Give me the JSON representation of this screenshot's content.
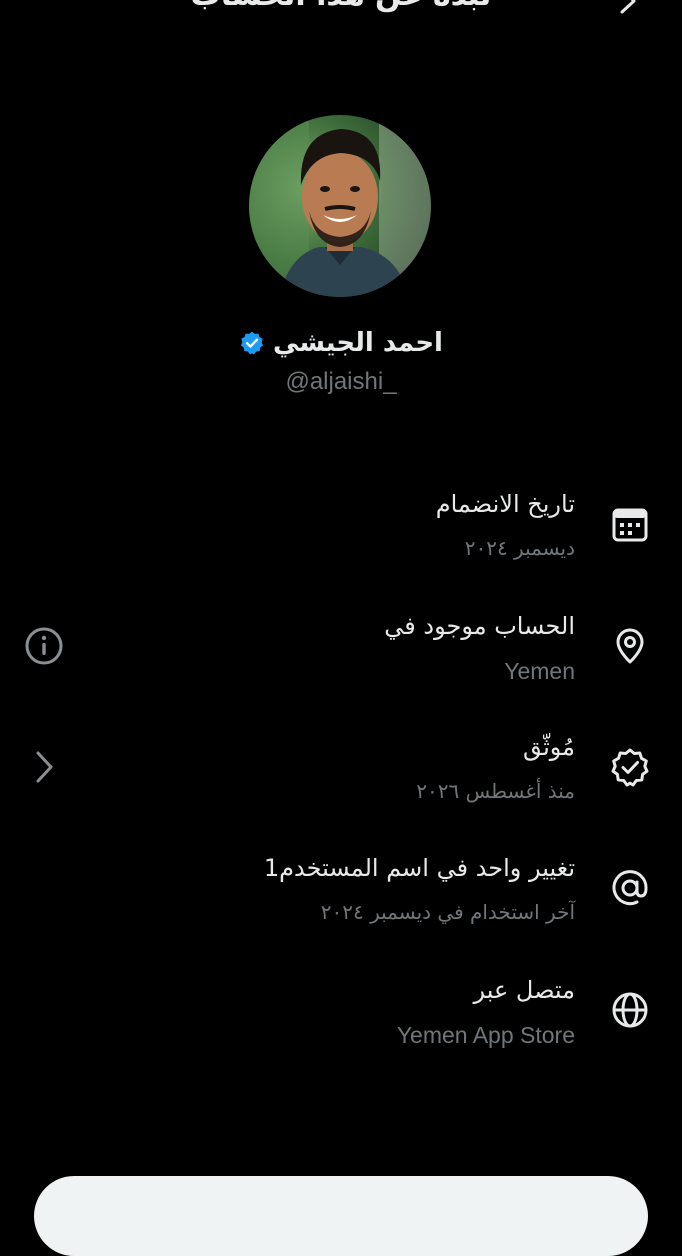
{
  "header": {
    "title": "نبذة عن هذا الحساب"
  },
  "profile": {
    "display_name": "احمد الجيشي",
    "handle": "@aljaishi_",
    "verified_color": "#1d9bf0"
  },
  "info_rows": [
    {
      "icon": "calendar-icon",
      "title": "تاريخ الانضمام",
      "subtitle": "ديسمبر ٢٠٢٤"
    },
    {
      "icon": "location-pin-icon",
      "title": "الحساب موجود في",
      "subtitle": "Yemen",
      "action_icon": "info-icon"
    },
    {
      "icon": "verified-check-icon",
      "title": "مُوثّق",
      "subtitle": "منذ أغسطس ٢٠٢٦",
      "action_icon": "chevron-left-icon"
    },
    {
      "icon": "at-sign-icon",
      "title": "تغيير واحد في اسم المستخدم1",
      "subtitle": "آخر استخدام في ديسمبر ٢٠٢٤"
    },
    {
      "icon": "globe-icon",
      "title": "متصل عبر",
      "subtitle": "Yemen App Store"
    }
  ],
  "colors": {
    "background": "#000000",
    "primary_text": "#e7e9ea",
    "secondary_text": "#71767b",
    "sheet": "#eff3f4"
  }
}
